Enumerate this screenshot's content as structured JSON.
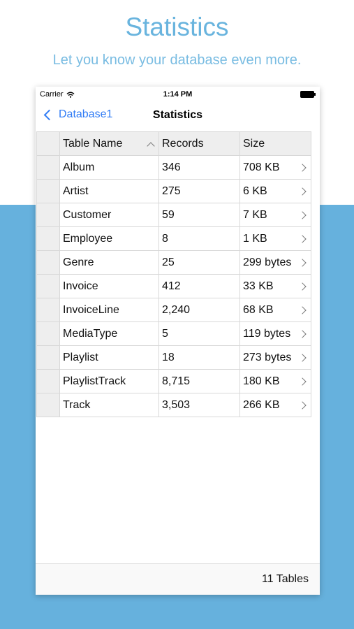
{
  "promo": {
    "headline": "Statistics",
    "subline": "Let you know your database even more."
  },
  "status_bar": {
    "carrier": "Carrier",
    "time": "1:14 PM"
  },
  "nav": {
    "back_label": "Database1",
    "title": "Statistics"
  },
  "table": {
    "headers": [
      "Table Name",
      "Records",
      "Size"
    ],
    "sort_column": "Table Name",
    "sort_direction": "ascending",
    "rows": [
      {
        "name": "Album",
        "records": "346",
        "size": "708 KB"
      },
      {
        "name": "Artist",
        "records": "275",
        "size": "6 KB"
      },
      {
        "name": "Customer",
        "records": "59",
        "size": "7 KB"
      },
      {
        "name": "Employee",
        "records": "8",
        "size": "1 KB"
      },
      {
        "name": "Genre",
        "records": "25",
        "size": "299 bytes"
      },
      {
        "name": "Invoice",
        "records": "412",
        "size": "33 KB"
      },
      {
        "name": "InvoiceLine",
        "records": "2,240",
        "size": "68 KB"
      },
      {
        "name": "MediaType",
        "records": "5",
        "size": "119 bytes"
      },
      {
        "name": "Playlist",
        "records": "18",
        "size": "273 bytes"
      },
      {
        "name": "PlaylistTrack",
        "records": "8,715",
        "size": "180 KB"
      },
      {
        "name": "Track",
        "records": "3,503",
        "size": "266 KB"
      }
    ]
  },
  "footer": {
    "count_label": "11 Tables"
  },
  "colors": {
    "accent_blue": "#2f7bf5",
    "promo_text": "#69b4de",
    "background_band": "#66b1dd"
  },
  "icons": {
    "back": "chevron-left-icon",
    "sort": "sort-ascending-icon",
    "row_disclosure": "chevron-right-icon",
    "wifi": "wifi-icon",
    "battery": "battery-icon"
  }
}
